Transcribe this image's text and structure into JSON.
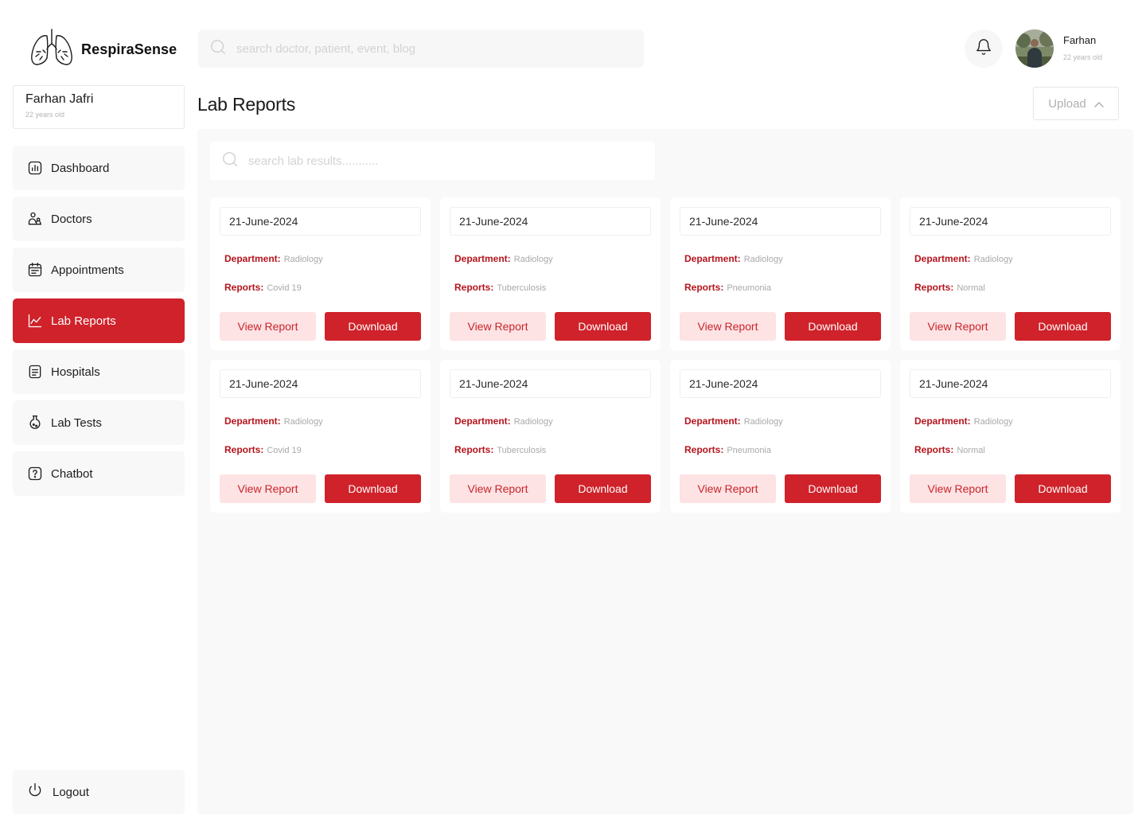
{
  "app": {
    "brand": "RespiraSense",
    "accent_color": "#cf222a",
    "logo_icon": "lungs-icon"
  },
  "sidebar": {
    "profile": {
      "name": "Farhan Jafri",
      "age": "22 years old"
    },
    "items": [
      {
        "label": "Dashboard",
        "icon": "chart-icon",
        "active": false
      },
      {
        "label": "Doctors",
        "icon": "doctor-icon",
        "active": false
      },
      {
        "label": "Appointments",
        "icon": "calendar-icon",
        "active": false
      },
      {
        "label": "Lab Reports",
        "icon": "line-chart-icon",
        "active": true
      },
      {
        "label": "Hospitals",
        "icon": "document-icon",
        "active": false
      },
      {
        "label": "Lab Tests",
        "icon": "flask-icon",
        "active": false
      },
      {
        "label": "Chatbot",
        "icon": "help-icon",
        "active": false
      }
    ],
    "logout_label": "Logout"
  },
  "header": {
    "search_placeholder": "search doctor, patient, event, blog",
    "user": {
      "name": "Farhan",
      "age": "22 years old"
    }
  },
  "main": {
    "title": "Lab Reports",
    "upload_label": "Upload",
    "search_placeholder": "search lab results...........",
    "department_key": "Department:",
    "reports_key": "Reports:",
    "view_label": "View Report",
    "download_label": "Download",
    "reports": [
      {
        "date": "21-June-2024",
        "department": "Radiology",
        "report": "Covid 19"
      },
      {
        "date": "21-June-2024",
        "department": "Radiology",
        "report": "Tuberculosis"
      },
      {
        "date": "21-June-2024",
        "department": "Radiology",
        "report": "Pneumonia"
      },
      {
        "date": "21-June-2024",
        "department": "Radiology",
        "report": "Normal"
      },
      {
        "date": "21-June-2024",
        "department": "Radiology",
        "report": "Covid 19"
      },
      {
        "date": "21-June-2024",
        "department": "Radiology",
        "report": "Tuberculosis"
      },
      {
        "date": "21-June-2024",
        "department": "Radiology",
        "report": "Pneumonia"
      },
      {
        "date": "21-June-2024",
        "department": "Radiology",
        "report": "Normal"
      }
    ]
  }
}
